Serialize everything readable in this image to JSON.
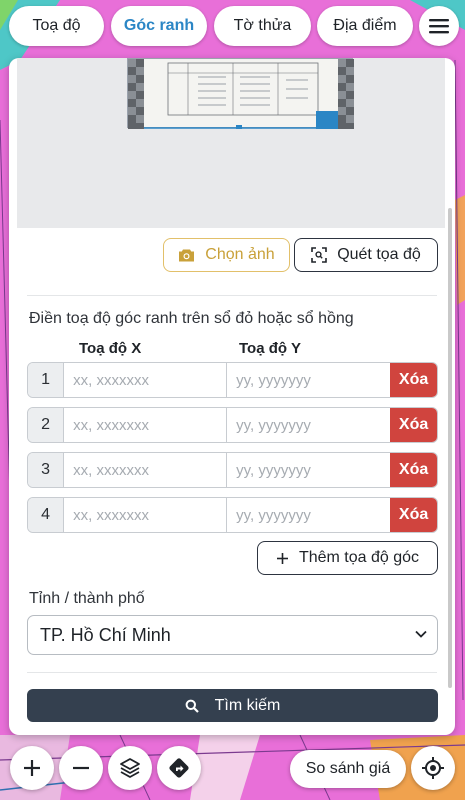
{
  "tabs": [
    {
      "label": "Toạ độ",
      "active": false
    },
    {
      "label": "Góc ranh",
      "active": true
    },
    {
      "label": "Tờ thửa",
      "active": false
    },
    {
      "label": "Địa điểm",
      "active": false
    }
  ],
  "menu_icon": "hamburger-menu-icon",
  "panel": {
    "choose_photo_label": "Chọn ảnh",
    "choose_photo_icon": "camera-icon",
    "scan_label": "Quét tọa độ",
    "scan_icon": "scan-frame-icon",
    "hint": "Điền toạ độ góc ranh trên sổ đỏ hoặc sổ hồng",
    "col_x": "Toạ độ X",
    "col_y": "Toạ độ Y",
    "rows": [
      {
        "index": "1",
        "x_placeholder": "xx, xxxxxxx",
        "y_placeholder": "yy, yyyyyyy",
        "delete_label": "Xóa"
      },
      {
        "index": "2",
        "x_placeholder": "xx, xxxxxxx",
        "y_placeholder": "yy, yyyyyyy",
        "delete_label": "Xóa"
      },
      {
        "index": "3",
        "x_placeholder": "xx, xxxxxxx",
        "y_placeholder": "yy, yyyyyyy",
        "delete_label": "Xóa"
      },
      {
        "index": "4",
        "x_placeholder": "xx, xxxxxxx",
        "y_placeholder": "yy, yyyyyyy",
        "delete_label": "Xóa"
      }
    ],
    "add_label": "Thêm tọa độ góc",
    "province_label": "Tỉnh / thành phố",
    "province_value": "TP. Hồ Chí Minh",
    "search_label": "Tìm kiếm",
    "search_icon": "magnifier-icon"
  },
  "map_controls": {
    "zoom_in_icon": "plus-icon",
    "zoom_out_icon": "minus-icon",
    "layers_icon": "layers-icon",
    "directions_icon": "directions-icon",
    "compare_label": "So sánh giá",
    "locate_icon": "crosshair-locate-icon"
  },
  "colors": {
    "map_pink": "#e86fd8",
    "accent_blue": "#2b86c5",
    "delete_red": "#d0443e",
    "search_dark": "#34404f",
    "photo_gold": "#c9a13a"
  }
}
